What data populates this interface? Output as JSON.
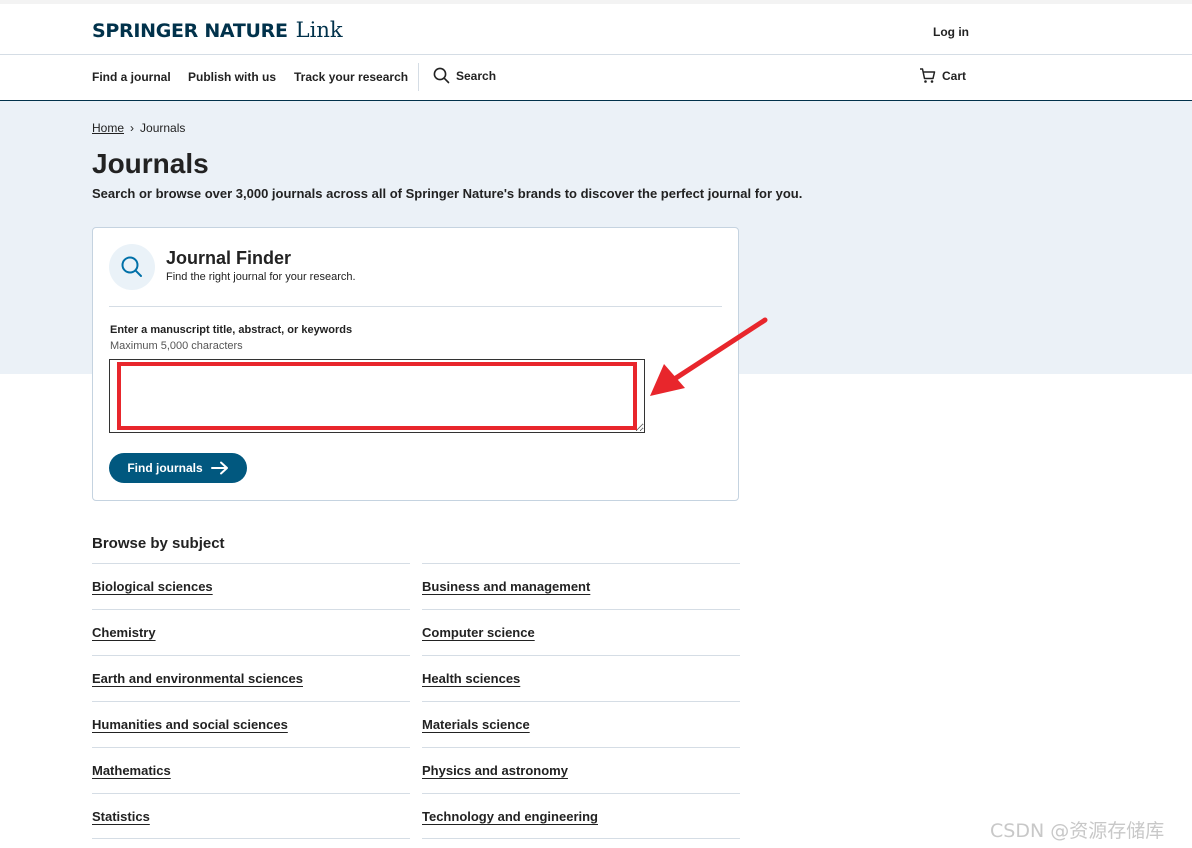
{
  "header": {
    "brand": "SPRINGER NATURE",
    "brand_suffix": "Link",
    "login_label": "Log in"
  },
  "nav": {
    "items": [
      "Find a journal",
      "Publish with us",
      "Track your research"
    ],
    "search_label": "Search",
    "cart_label": "Cart"
  },
  "breadcrumb": {
    "home": "Home",
    "separator": "›",
    "current": "Journals"
  },
  "page": {
    "title": "Journals",
    "description": "Search or browse over 3,000 journals across all of Springer Nature's brands to discover the perfect journal for you."
  },
  "finder": {
    "title": "Journal Finder",
    "subtitle": "Find the right journal for your research.",
    "field_label": "Enter a manuscript title, abstract, or keywords",
    "field_hint": "Maximum 5,000 characters",
    "field_value": "",
    "button_label": "Find journals"
  },
  "browse": {
    "heading": "Browse by subject",
    "left": [
      "Biological sciences",
      "Chemistry",
      "Earth and environmental sciences",
      "Humanities and social sciences",
      "Mathematics",
      "Statistics"
    ],
    "right": [
      "Business and management",
      "Computer science",
      "Health sciences",
      "Materials science",
      "Physics and astronomy",
      "Technology and engineering"
    ]
  },
  "watermark": "CSDN @资源存储库",
  "colors": {
    "brand_dark": "#01324b",
    "button": "#01587f",
    "hero_bg": "#ebf1f7",
    "annotation_red": "#e8262c",
    "search_icon": "#0070a8"
  }
}
